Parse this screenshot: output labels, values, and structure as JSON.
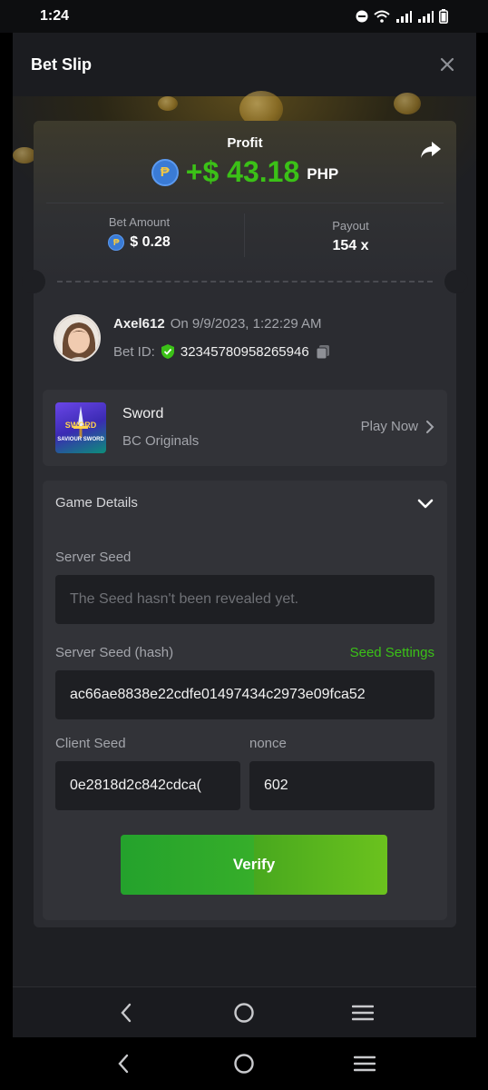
{
  "status_bar": {
    "time": "1:24"
  },
  "header": {
    "title": "Bet Slip"
  },
  "profit": {
    "label": "Profit",
    "value": "+$ 43.18",
    "currency": "PHP",
    "coin_symbol": "₱"
  },
  "stats": {
    "bet_amount_label": "Bet Amount",
    "bet_amount_value": "$ 0.28",
    "payout_label": "Payout",
    "payout_value": "154 x"
  },
  "user": {
    "name": "Axel612",
    "date": "On 9/9/2023, 1:22:29 AM",
    "bet_id_label": "Bet ID:",
    "bet_id": "32345780958265946"
  },
  "game": {
    "name": "Sword",
    "provider": "BC Originals",
    "play_label": "Play Now",
    "thumb_text_top": "SWORD",
    "thumb_text_bottom": "SAVIOUR SWORD"
  },
  "details": {
    "title": "Game Details",
    "server_seed_label": "Server Seed",
    "server_seed_value": "The Seed hasn't been revealed yet.",
    "server_hash_label": "Server Seed (hash)",
    "seed_settings_label": "Seed Settings",
    "server_hash_value": "ac66ae8838e22cdfe01497434c2973e09fca52",
    "client_seed_label": "Client Seed",
    "client_seed_value": "0e2818d2c842cdca(",
    "nonce_label": "nonce",
    "nonce_value": "602",
    "verify_label": "Verify"
  },
  "colors": {
    "accent_green": "#3bc117",
    "background": "#1e1f23",
    "card": "#2b2c31"
  }
}
